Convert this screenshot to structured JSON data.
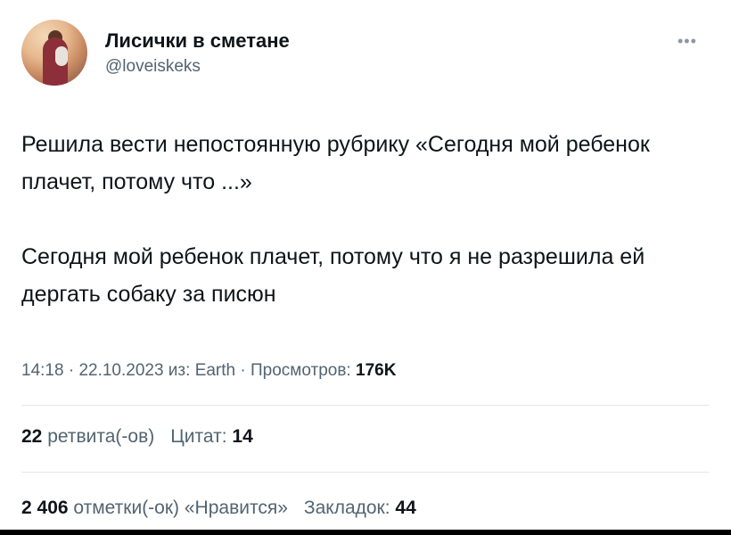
{
  "author": {
    "display_name": "Лисички в сметане",
    "handle": "@loveiskeks"
  },
  "tweet": {
    "paragraph_1": "Решила вести непостоянную рубрику «Сегодня мой ребенок плачет, потому что ...»",
    "paragraph_2": "Сегодня мой ребенок плачет, потому что я не разрешила ей дергать собаку за писюн"
  },
  "meta": {
    "time": "14:18",
    "sep1": " · ",
    "date": "22.10.2023",
    "source": " из: Earth",
    "sep2": " · ",
    "views_label": "Просмотров: ",
    "views_value": "176K"
  },
  "stats": {
    "retweets_value": "22",
    "retweets_label": " ретвита(-ов)",
    "quotes_label": "Цитат: ",
    "quotes_value": "14",
    "likes_value": "2 406",
    "likes_label": " отметки(-ок) «Нравится»",
    "bookmarks_label": "Закладок: ",
    "bookmarks_value": "44"
  },
  "icons": {
    "more": "more-horizontal-icon"
  }
}
